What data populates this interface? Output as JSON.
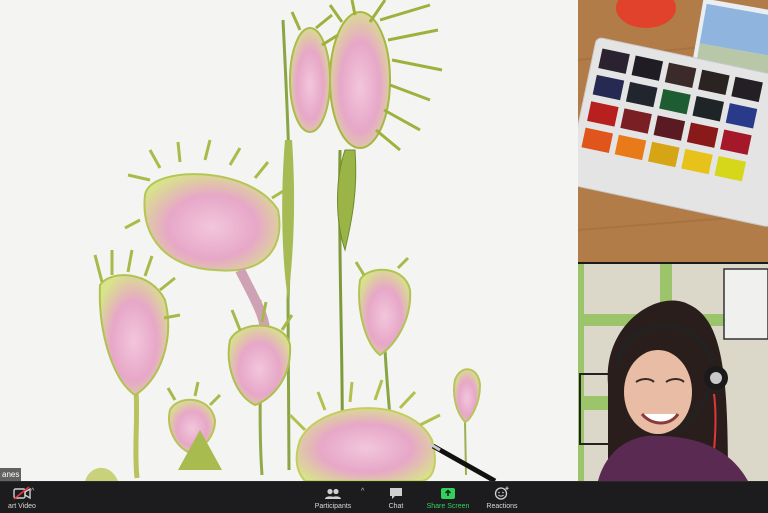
{
  "participant_name": "anes",
  "toolbar": {
    "video_label": "art Video",
    "participants_label": "Participants",
    "chat_label": "Chat",
    "share_label": "Share Screen",
    "reactions_label": "Reactions",
    "caret": "^"
  },
  "colors": {
    "toolbar_bg": "#1c1c1e",
    "share_green": "#31d15a",
    "video_off_red": "#e0373a"
  }
}
